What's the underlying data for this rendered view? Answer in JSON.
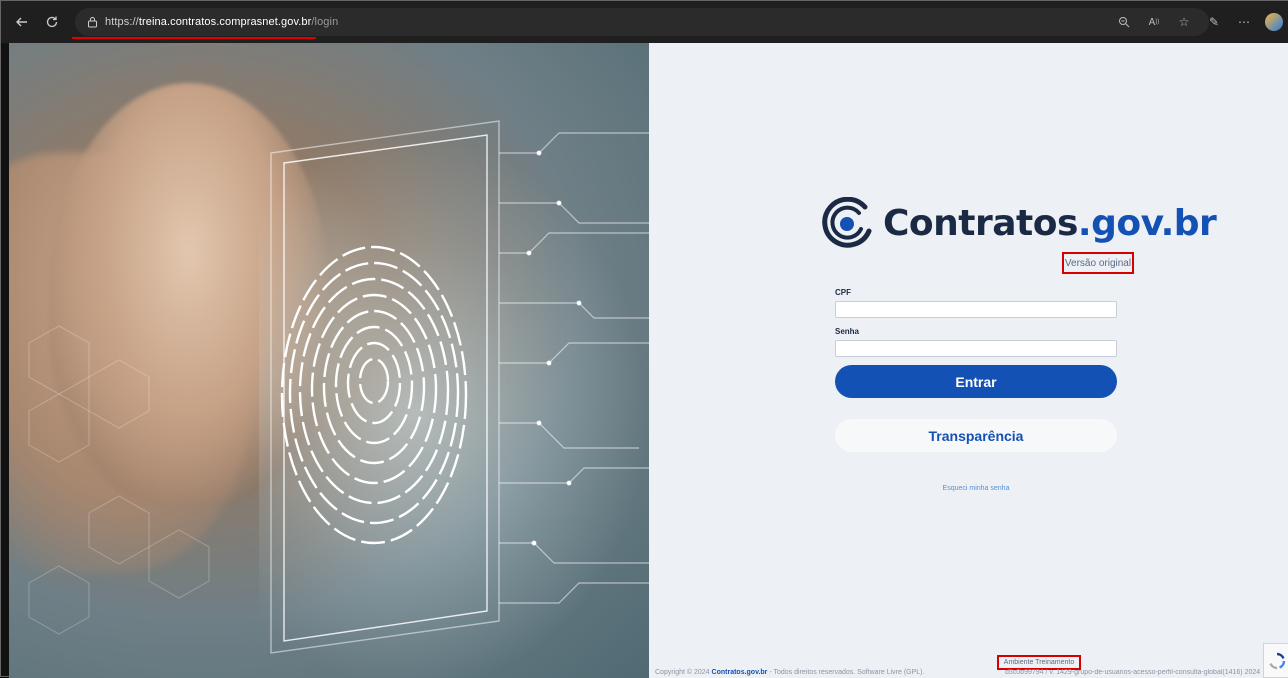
{
  "browser": {
    "url_scheme": "https://",
    "url_host": "treina.contratos.comprasnet.gov.br",
    "url_path": "/login"
  },
  "brand": {
    "name_prefix": "Contratos",
    "name_suffix": ".gov.br",
    "primary_color": "#1351b4"
  },
  "login": {
    "version_link": "Versão original",
    "cpf_label": "CPF",
    "cpf_value": "",
    "password_label": "Senha",
    "password_value": "",
    "submit_label": "Entrar",
    "transparency_label": "Transparência",
    "forgot_password": "Esqueci minha senha"
  },
  "footer": {
    "copyright_prefix": "Copyright © 2024 ",
    "copyright_brand": "Contratos.gov.br",
    "copyright_suffix": " - Todos direitos reservados. Software Livre (GPL).",
    "environment": "Ambiente Treinamento",
    "version_info": "d5c0b99794 / v. 1429-grupo-de-usuarios-acesso-perfil-consulta-global(1416) 2024"
  }
}
